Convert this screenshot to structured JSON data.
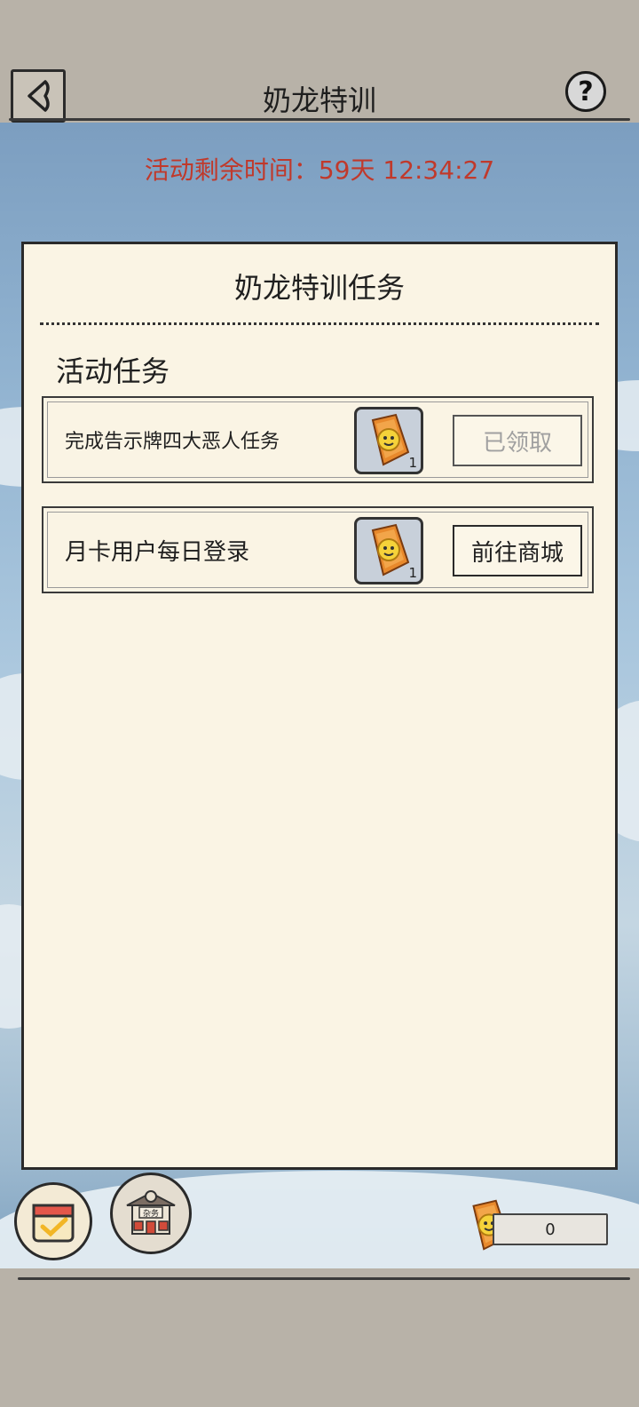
{
  "header": {
    "title": "奶龙特训"
  },
  "timer": {
    "text": "活动剩余时间：59天 12:34:27"
  },
  "panel": {
    "title": "奶龙特训任务",
    "section_title": "活动任务",
    "tasks": [
      {
        "label": "完成告示牌四大恶人任务",
        "reward_count": "1",
        "button": "已领取"
      },
      {
        "label": "月卡用户每日登录",
        "reward_count": "1",
        "button": "前往商城"
      }
    ]
  },
  "bottom": {
    "shop_sign": "杂务",
    "currency_value": "0"
  },
  "colors": {
    "timer": "#c0392b",
    "panel_bg": "#faf4e4",
    "accent_orange": "#e8892c"
  }
}
